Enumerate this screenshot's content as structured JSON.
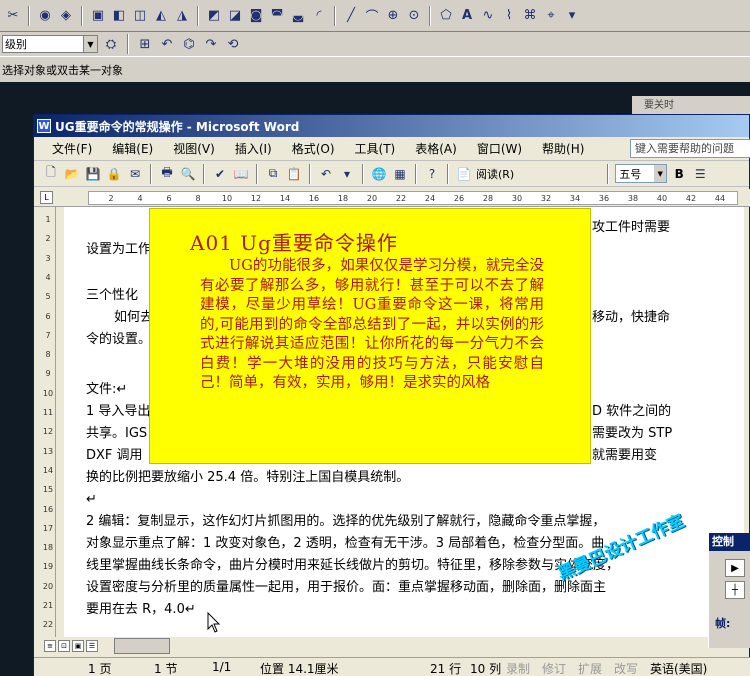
{
  "ug": {
    "select_value": "级别",
    "status_text": "选择对象或双击某一对象",
    "side_label": "要关时"
  },
  "word": {
    "title": "UG重要命令的常规操作 - Microsoft Word",
    "menu": [
      "文件(F)",
      "编辑(E)",
      "视图(V)",
      "插入(I)",
      "格式(O)",
      "工具(T)",
      "表格(A)",
      "窗口(W)",
      "帮助(H)"
    ],
    "help_placeholder": "键入需要帮助的问题",
    "read_label": "阅读(R)",
    "font_size": "五号",
    "bold": "B",
    "ruler_ticks": [
      "2",
      "4",
      "6",
      "8",
      "10",
      "12",
      "14",
      "16",
      "18",
      "20",
      "22",
      "24",
      "26",
      "28",
      "30",
      "32",
      "34",
      "36",
      "38",
      "40",
      "42",
      "44"
    ],
    "vruler_ticks": [
      "1",
      "2",
      "3",
      "4",
      "5",
      "6",
      "7",
      "8",
      "9",
      "10",
      "11",
      "12",
      "13",
      "14",
      "15",
      "16",
      "17",
      "18",
      "19",
      "20",
      "21",
      "22"
    ],
    "doc_lines": [
      "设置为工作",
      "三个性化",
      "如何去",
      "令的设置。",
      "文件:↵",
      "1 导入导出",
      "共享。IGS",
      "DXF 调用",
      "换的比例把要放缩小 25.4 倍。特别注上国自模具统制。",
      "↵",
      "2 编辑：复制显示，这作幻灯片抓图用的。选择的优先级别了解就行，隐藏命令重点掌握，",
      "对象显示重点了解：1 改变对象色，2 透明，检查有无干涉。3 局部着色，检查分型面。曲",
      "线里掌握曲线长条命令，曲片分模时用来延长线做片的剪切。特征里，移除参数与实体密度，",
      "设置密度与分析里的质量属性一起用，用于报价。面：重点掌握移动面，删除面，删除面主",
      "要用在去 R，4.0↵"
    ],
    "doc_right_fragments": [
      "攻工件时需要",
      "移动，快捷命",
      "D 软件之间的",
      "需要改为 STP",
      "就需要用变"
    ],
    "status": {
      "page": "1 页",
      "section": "1 节",
      "page_of": "1/1",
      "position": "位置 14.1厘米",
      "line": "21 行",
      "col": "10 列",
      "rec": "录制",
      "trk": "修订",
      "ext": "扩展",
      "ovr": "改写",
      "lang": "英语(美国)"
    }
  },
  "overlay": {
    "title": "A01  Ug重要命令操作",
    "body": "UG的功能很多，如果仅仅是学习分模，就完全没有必要了解那么多，够用就行！甚至于可以不去了解建模，尽量少用草绘！UG重要命令这一课，将常用的,可能用到的命令全部总结到了一起，并以实例的形式进行解说其适应范围！让你所花的每一分气力不会白费！学一大堆的没用的技巧与方法，只能安慰自己！简单，有效，实用，够用！是求实的风格"
  },
  "control": {
    "title": "控制",
    "frame_label": "帧:"
  },
  "watermark": "黑曼巴设计工作室",
  "colors": {
    "overlay_bg": "#ffff00",
    "overlay_text": "#b01818",
    "title_bar": "#0a246a",
    "watermark": "#00d0ff"
  }
}
